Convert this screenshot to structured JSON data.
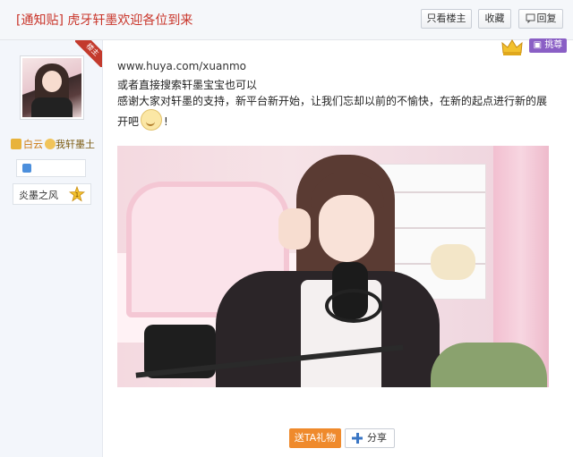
{
  "header": {
    "title": "[通知贴] 虎牙轩墨欢迎各位到来",
    "buttons": {
      "only_op": "只看楼主",
      "favorite": "收藏",
      "reply": "回复"
    }
  },
  "user": {
    "role_ribbon": "楼主",
    "name_part1": "白云",
    "name_part2": "我轩墨土",
    "badge_text": "炎墨之风",
    "badge_level": "1",
    "vip_label": "挑尊"
  },
  "post": {
    "link": "www.huya.com/xuanmo",
    "line1": "或者直接搜索轩墨宝宝也可以",
    "line2": "感谢大家对轩墨的支持，新平台新开始，让我们忘却以前的不愉快，在新的起点进行新的展",
    "line3_prefix": "开吧",
    "line3_suffix": "!"
  },
  "actions": {
    "gift": "送TA礼物",
    "share": "分享"
  },
  "colors": {
    "title_red": "#c9352a",
    "gift_orange": "#ef8a2c",
    "vip_purple": "#8a5fc5"
  }
}
